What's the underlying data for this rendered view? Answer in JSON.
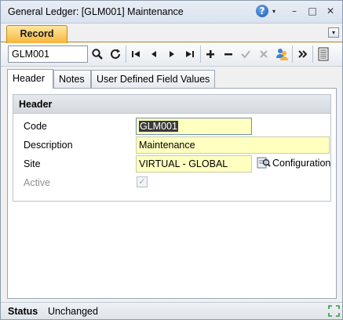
{
  "window": {
    "title": "General Ledger: [GLM001] Maintenance",
    "help_glyph": "?",
    "caret_glyph": "▾",
    "minimize_glyph": "–",
    "restore_glyph": "□",
    "close_glyph": "✕"
  },
  "ribbon": {
    "active_tab": "Record",
    "collapse_glyph": "▾"
  },
  "toolbar": {
    "search_value": "GLM001",
    "search_glyph": "🔍",
    "refresh_glyph": "↻",
    "first_glyph": "|◀",
    "prev_glyph": "◀",
    "next_glyph": "▶",
    "last_glyph": "▶|",
    "add_glyph": "+",
    "remove_glyph": "−",
    "check_glyph": "✓",
    "cancel_glyph": "✕",
    "more_glyph": "»"
  },
  "tabs": [
    {
      "label": "Header"
    },
    {
      "label": "Notes"
    },
    {
      "label": "User Defined Field Values"
    }
  ],
  "header_group": {
    "title": "Header",
    "code_label": "Code",
    "code_value": "GLM001",
    "description_label": "Description",
    "description_value": "Maintenance",
    "site_label": "Site",
    "site_value": "VIRTUAL - GLOBAL",
    "config_label": "Configuration",
    "active_label": "Active",
    "active_checked": true,
    "active_glyph": "✓"
  },
  "status": {
    "label": "Status",
    "value": "Unchanged"
  },
  "colors": {
    "ribbon_tab": "#f7b63c",
    "field_bg": "#ffffc0",
    "window_border": "#8c9bad"
  }
}
